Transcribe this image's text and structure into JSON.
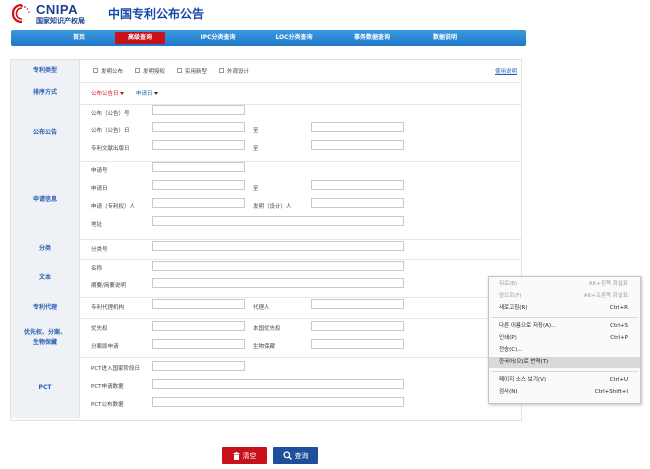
{
  "header": {
    "logo_text": "CNIPA",
    "logo_cn": "国家知识产权局",
    "title": "中国专利公布公告"
  },
  "nav": {
    "items": [
      "首页",
      "高级查询",
      "IPC分类查询",
      "LOC分类查询",
      "事务数据查询",
      "数据说明"
    ],
    "active": "高级查询"
  },
  "form": {
    "patent_type": {
      "label": "专利类型",
      "options": [
        "发明公布",
        "发明授权",
        "实用新型",
        "外观设计"
      ],
      "help": "使用说明"
    },
    "sort": {
      "label": "排序方式",
      "option1": "公布公告日",
      "option2": "申请日"
    },
    "publication": {
      "label": "公布公告",
      "pub_no": "公布（公告）号",
      "pub_date": "公布（公告）日",
      "doc_date": "专利文献出版日",
      "to": "至"
    },
    "application": {
      "label": "申请信息",
      "app_no": "申请号",
      "app_date": "申请日",
      "applicant": "申请（专利权）人",
      "inventor": "发明（设计）人",
      "address": "地址",
      "to": "至"
    },
    "classification": {
      "label": "分类",
      "class_no": "分类号"
    },
    "text": {
      "label": "文本",
      "name": "名称",
      "abstract": "摘要/简要说明"
    },
    "agency": {
      "label": "专利代理",
      "agency": "专利代理机构",
      "agent": "代理人"
    },
    "priority": {
      "label_line1": "优先权、分案、",
      "label_line2": "生物保藏",
      "priority": "优先权",
      "domestic_priority": "本国优先权",
      "divisional": "分案原申请",
      "bio_deposit": "生物保藏"
    },
    "pct": {
      "label": "PCT",
      "entry_date": "PCT进入国家阶段日",
      "app_data": "PCT申请数据",
      "pub_data": "PCT公布数据"
    }
  },
  "buttons": {
    "clear": "清空",
    "search": "查询"
  },
  "context_menu": {
    "items": [
      {
        "label": "뒤로(B)",
        "shortcut": "Alt+왼쪽 화살표",
        "disabled": true
      },
      {
        "label": "앞으로(F)",
        "shortcut": "Alt+오른쪽 화살표",
        "disabled": true
      },
      {
        "label": "새로고침(R)",
        "shortcut": "Ctrl+R",
        "disabled": false
      },
      {
        "label": "다른 이름으로 저장(A)...",
        "shortcut": "Ctrl+S",
        "disabled": false
      },
      {
        "label": "인쇄(P)",
        "shortcut": "Ctrl+P",
        "disabled": false
      },
      {
        "label": "전송(C)...",
        "shortcut": "",
        "disabled": false
      },
      {
        "label": "한국어(으)로 번역(T)",
        "shortcut": "",
        "disabled": false,
        "highlighted": true
      },
      {
        "label": "페이지 소스 보기(V)",
        "shortcut": "Ctrl+U",
        "disabled": false
      },
      {
        "label": "검사(N)",
        "shortcut": "Ctrl+Shift+I",
        "disabled": false
      }
    ]
  },
  "colors": {
    "nav_blue": "#1f77c8",
    "brand_red": "#c8121b",
    "label_blue": "#2a5fb3",
    "search_btn": "#1d4f9c"
  }
}
